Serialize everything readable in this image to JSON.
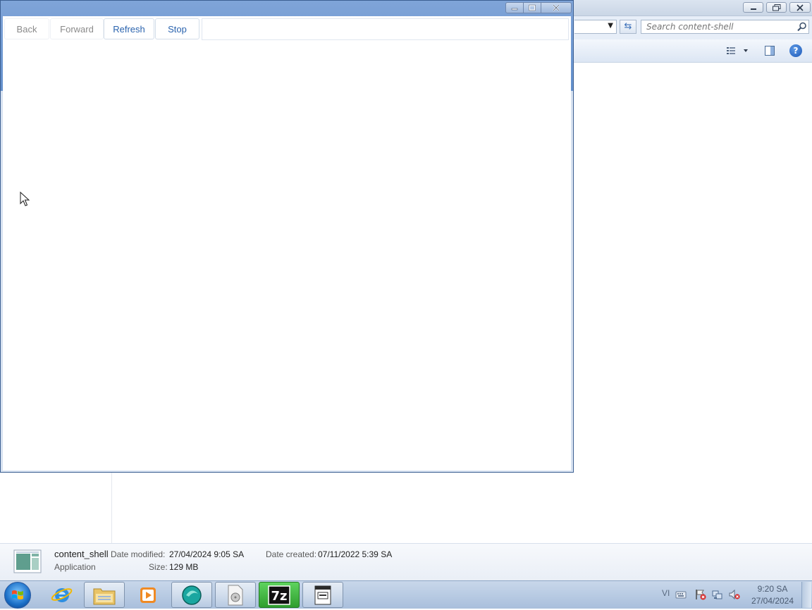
{
  "explorer": {
    "search_placeholder": "Search content-shell",
    "details": {
      "file_name": "content_shell",
      "file_type": "Application",
      "date_modified_label": "Date modified:",
      "date_modified": "27/04/2024 9:05 SA",
      "size_label": "Size:",
      "size": "129 MB",
      "date_created_label": "Date created:",
      "date_created": "07/11/2022 5:39 SA"
    }
  },
  "content_shell": {
    "back_label": "Back",
    "forward_label": "Forward",
    "refresh_label": "Refresh",
    "stop_label": "Stop",
    "url_value": ""
  },
  "taskbar": {
    "pinned": [
      {
        "name": "internet-explorer",
        "icon": "ie-icon"
      },
      {
        "name": "windows-explorer",
        "icon": "folder-icon"
      },
      {
        "name": "media-player",
        "icon": "media-player-icon"
      },
      {
        "name": "app-teal",
        "icon": "teal-app-icon"
      },
      {
        "name": "app-disc",
        "icon": "disc-icon"
      },
      {
        "name": "7zip",
        "icon": "7zip-icon"
      },
      {
        "name": "content-shell",
        "icon": "content-shell-icon"
      }
    ],
    "tray": {
      "language": "VI",
      "time": "9:20 SA",
      "date": "27/04/2024"
    }
  },
  "colors": {
    "window_frame": "#6390cc",
    "link_blue": "#2a63ae",
    "taskbar": "#b9cbe3"
  }
}
